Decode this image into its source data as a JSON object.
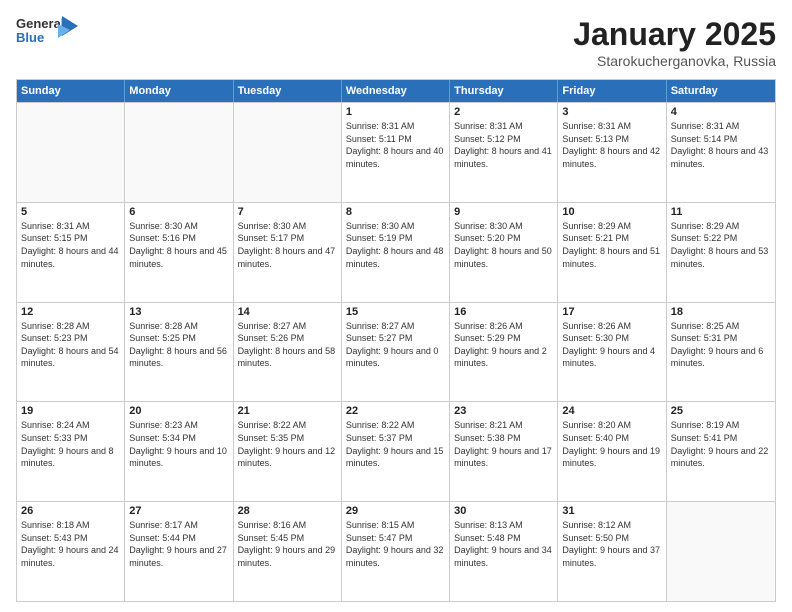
{
  "logo": {
    "general": "General",
    "blue": "Blue"
  },
  "header": {
    "month": "January 2025",
    "location": "Starokucherganovka, Russia"
  },
  "weekdays": [
    "Sunday",
    "Monday",
    "Tuesday",
    "Wednesday",
    "Thursday",
    "Friday",
    "Saturday"
  ],
  "rows": [
    [
      {
        "day": "",
        "sunrise": "",
        "sunset": "",
        "daylight": ""
      },
      {
        "day": "",
        "sunrise": "",
        "sunset": "",
        "daylight": ""
      },
      {
        "day": "",
        "sunrise": "",
        "sunset": "",
        "daylight": ""
      },
      {
        "day": "1",
        "sunrise": "Sunrise: 8:31 AM",
        "sunset": "Sunset: 5:11 PM",
        "daylight": "Daylight: 8 hours and 40 minutes."
      },
      {
        "day": "2",
        "sunrise": "Sunrise: 8:31 AM",
        "sunset": "Sunset: 5:12 PM",
        "daylight": "Daylight: 8 hours and 41 minutes."
      },
      {
        "day": "3",
        "sunrise": "Sunrise: 8:31 AM",
        "sunset": "Sunset: 5:13 PM",
        "daylight": "Daylight: 8 hours and 42 minutes."
      },
      {
        "day": "4",
        "sunrise": "Sunrise: 8:31 AM",
        "sunset": "Sunset: 5:14 PM",
        "daylight": "Daylight: 8 hours and 43 minutes."
      }
    ],
    [
      {
        "day": "5",
        "sunrise": "Sunrise: 8:31 AM",
        "sunset": "Sunset: 5:15 PM",
        "daylight": "Daylight: 8 hours and 44 minutes."
      },
      {
        "day": "6",
        "sunrise": "Sunrise: 8:30 AM",
        "sunset": "Sunset: 5:16 PM",
        "daylight": "Daylight: 8 hours and 45 minutes."
      },
      {
        "day": "7",
        "sunrise": "Sunrise: 8:30 AM",
        "sunset": "Sunset: 5:17 PM",
        "daylight": "Daylight: 8 hours and 47 minutes."
      },
      {
        "day": "8",
        "sunrise": "Sunrise: 8:30 AM",
        "sunset": "Sunset: 5:19 PM",
        "daylight": "Daylight: 8 hours and 48 minutes."
      },
      {
        "day": "9",
        "sunrise": "Sunrise: 8:30 AM",
        "sunset": "Sunset: 5:20 PM",
        "daylight": "Daylight: 8 hours and 50 minutes."
      },
      {
        "day": "10",
        "sunrise": "Sunrise: 8:29 AM",
        "sunset": "Sunset: 5:21 PM",
        "daylight": "Daylight: 8 hours and 51 minutes."
      },
      {
        "day": "11",
        "sunrise": "Sunrise: 8:29 AM",
        "sunset": "Sunset: 5:22 PM",
        "daylight": "Daylight: 8 hours and 53 minutes."
      }
    ],
    [
      {
        "day": "12",
        "sunrise": "Sunrise: 8:28 AM",
        "sunset": "Sunset: 5:23 PM",
        "daylight": "Daylight: 8 hours and 54 minutes."
      },
      {
        "day": "13",
        "sunrise": "Sunrise: 8:28 AM",
        "sunset": "Sunset: 5:25 PM",
        "daylight": "Daylight: 8 hours and 56 minutes."
      },
      {
        "day": "14",
        "sunrise": "Sunrise: 8:27 AM",
        "sunset": "Sunset: 5:26 PM",
        "daylight": "Daylight: 8 hours and 58 minutes."
      },
      {
        "day": "15",
        "sunrise": "Sunrise: 8:27 AM",
        "sunset": "Sunset: 5:27 PM",
        "daylight": "Daylight: 9 hours and 0 minutes."
      },
      {
        "day": "16",
        "sunrise": "Sunrise: 8:26 AM",
        "sunset": "Sunset: 5:29 PM",
        "daylight": "Daylight: 9 hours and 2 minutes."
      },
      {
        "day": "17",
        "sunrise": "Sunrise: 8:26 AM",
        "sunset": "Sunset: 5:30 PM",
        "daylight": "Daylight: 9 hours and 4 minutes."
      },
      {
        "day": "18",
        "sunrise": "Sunrise: 8:25 AM",
        "sunset": "Sunset: 5:31 PM",
        "daylight": "Daylight: 9 hours and 6 minutes."
      }
    ],
    [
      {
        "day": "19",
        "sunrise": "Sunrise: 8:24 AM",
        "sunset": "Sunset: 5:33 PM",
        "daylight": "Daylight: 9 hours and 8 minutes."
      },
      {
        "day": "20",
        "sunrise": "Sunrise: 8:23 AM",
        "sunset": "Sunset: 5:34 PM",
        "daylight": "Daylight: 9 hours and 10 minutes."
      },
      {
        "day": "21",
        "sunrise": "Sunrise: 8:22 AM",
        "sunset": "Sunset: 5:35 PM",
        "daylight": "Daylight: 9 hours and 12 minutes."
      },
      {
        "day": "22",
        "sunrise": "Sunrise: 8:22 AM",
        "sunset": "Sunset: 5:37 PM",
        "daylight": "Daylight: 9 hours and 15 minutes."
      },
      {
        "day": "23",
        "sunrise": "Sunrise: 8:21 AM",
        "sunset": "Sunset: 5:38 PM",
        "daylight": "Daylight: 9 hours and 17 minutes."
      },
      {
        "day": "24",
        "sunrise": "Sunrise: 8:20 AM",
        "sunset": "Sunset: 5:40 PM",
        "daylight": "Daylight: 9 hours and 19 minutes."
      },
      {
        "day": "25",
        "sunrise": "Sunrise: 8:19 AM",
        "sunset": "Sunset: 5:41 PM",
        "daylight": "Daylight: 9 hours and 22 minutes."
      }
    ],
    [
      {
        "day": "26",
        "sunrise": "Sunrise: 8:18 AM",
        "sunset": "Sunset: 5:43 PM",
        "daylight": "Daylight: 9 hours and 24 minutes."
      },
      {
        "day": "27",
        "sunrise": "Sunrise: 8:17 AM",
        "sunset": "Sunset: 5:44 PM",
        "daylight": "Daylight: 9 hours and 27 minutes."
      },
      {
        "day": "28",
        "sunrise": "Sunrise: 8:16 AM",
        "sunset": "Sunset: 5:45 PM",
        "daylight": "Daylight: 9 hours and 29 minutes."
      },
      {
        "day": "29",
        "sunrise": "Sunrise: 8:15 AM",
        "sunset": "Sunset: 5:47 PM",
        "daylight": "Daylight: 9 hours and 32 minutes."
      },
      {
        "day": "30",
        "sunrise": "Sunrise: 8:13 AM",
        "sunset": "Sunset: 5:48 PM",
        "daylight": "Daylight: 9 hours and 34 minutes."
      },
      {
        "day": "31",
        "sunrise": "Sunrise: 8:12 AM",
        "sunset": "Sunset: 5:50 PM",
        "daylight": "Daylight: 9 hours and 37 minutes."
      },
      {
        "day": "",
        "sunrise": "",
        "sunset": "",
        "daylight": ""
      }
    ]
  ]
}
